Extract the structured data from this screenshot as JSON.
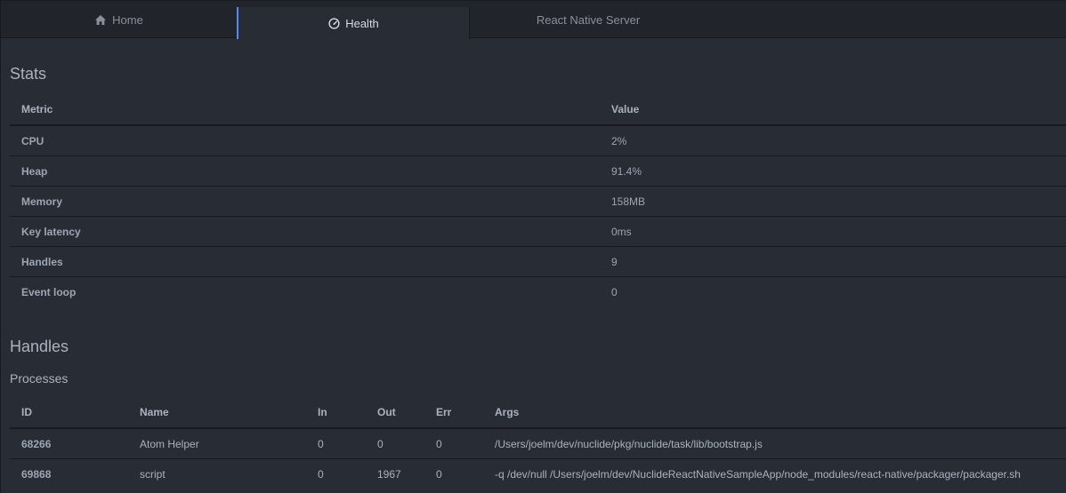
{
  "tabs": [
    {
      "label": "Home",
      "icon": "home-icon"
    },
    {
      "label": "Health",
      "icon": "dashboard-icon",
      "active": true
    },
    {
      "label": "React Native Server"
    }
  ],
  "stats": {
    "title": "Stats",
    "headers": {
      "metric": "Metric",
      "value": "Value"
    },
    "rows": [
      {
        "metric": "CPU",
        "value": "2%"
      },
      {
        "metric": "Heap",
        "value": "91.4%"
      },
      {
        "metric": "Memory",
        "value": "158MB"
      },
      {
        "metric": "Key latency",
        "value": "0ms"
      },
      {
        "metric": "Handles",
        "value": "9"
      },
      {
        "metric": "Event loop",
        "value": "0"
      }
    ]
  },
  "handles": {
    "title": "Handles",
    "processes_title": "Processes",
    "headers": {
      "id": "ID",
      "name": "Name",
      "in": "In",
      "out": "Out",
      "err": "Err",
      "args": "Args"
    },
    "rows": [
      {
        "id": "68266",
        "name": "Atom Helper",
        "in": "0",
        "out": "0",
        "err": "0",
        "args": "/Users/joelm/dev/nuclide/pkg/nuclide/task/lib/bootstrap.js"
      },
      {
        "id": "69868",
        "name": "script",
        "in": "0",
        "out": "1967",
        "err": "0",
        "args": "-q /dev/null /Users/joelm/dev/NuclideReactNativeSampleApp/node_modules/react-native/packager/packager.sh"
      }
    ]
  },
  "colors": {
    "background": "#282c34",
    "tabbar": "#21252b",
    "accent": "#568af2"
  }
}
